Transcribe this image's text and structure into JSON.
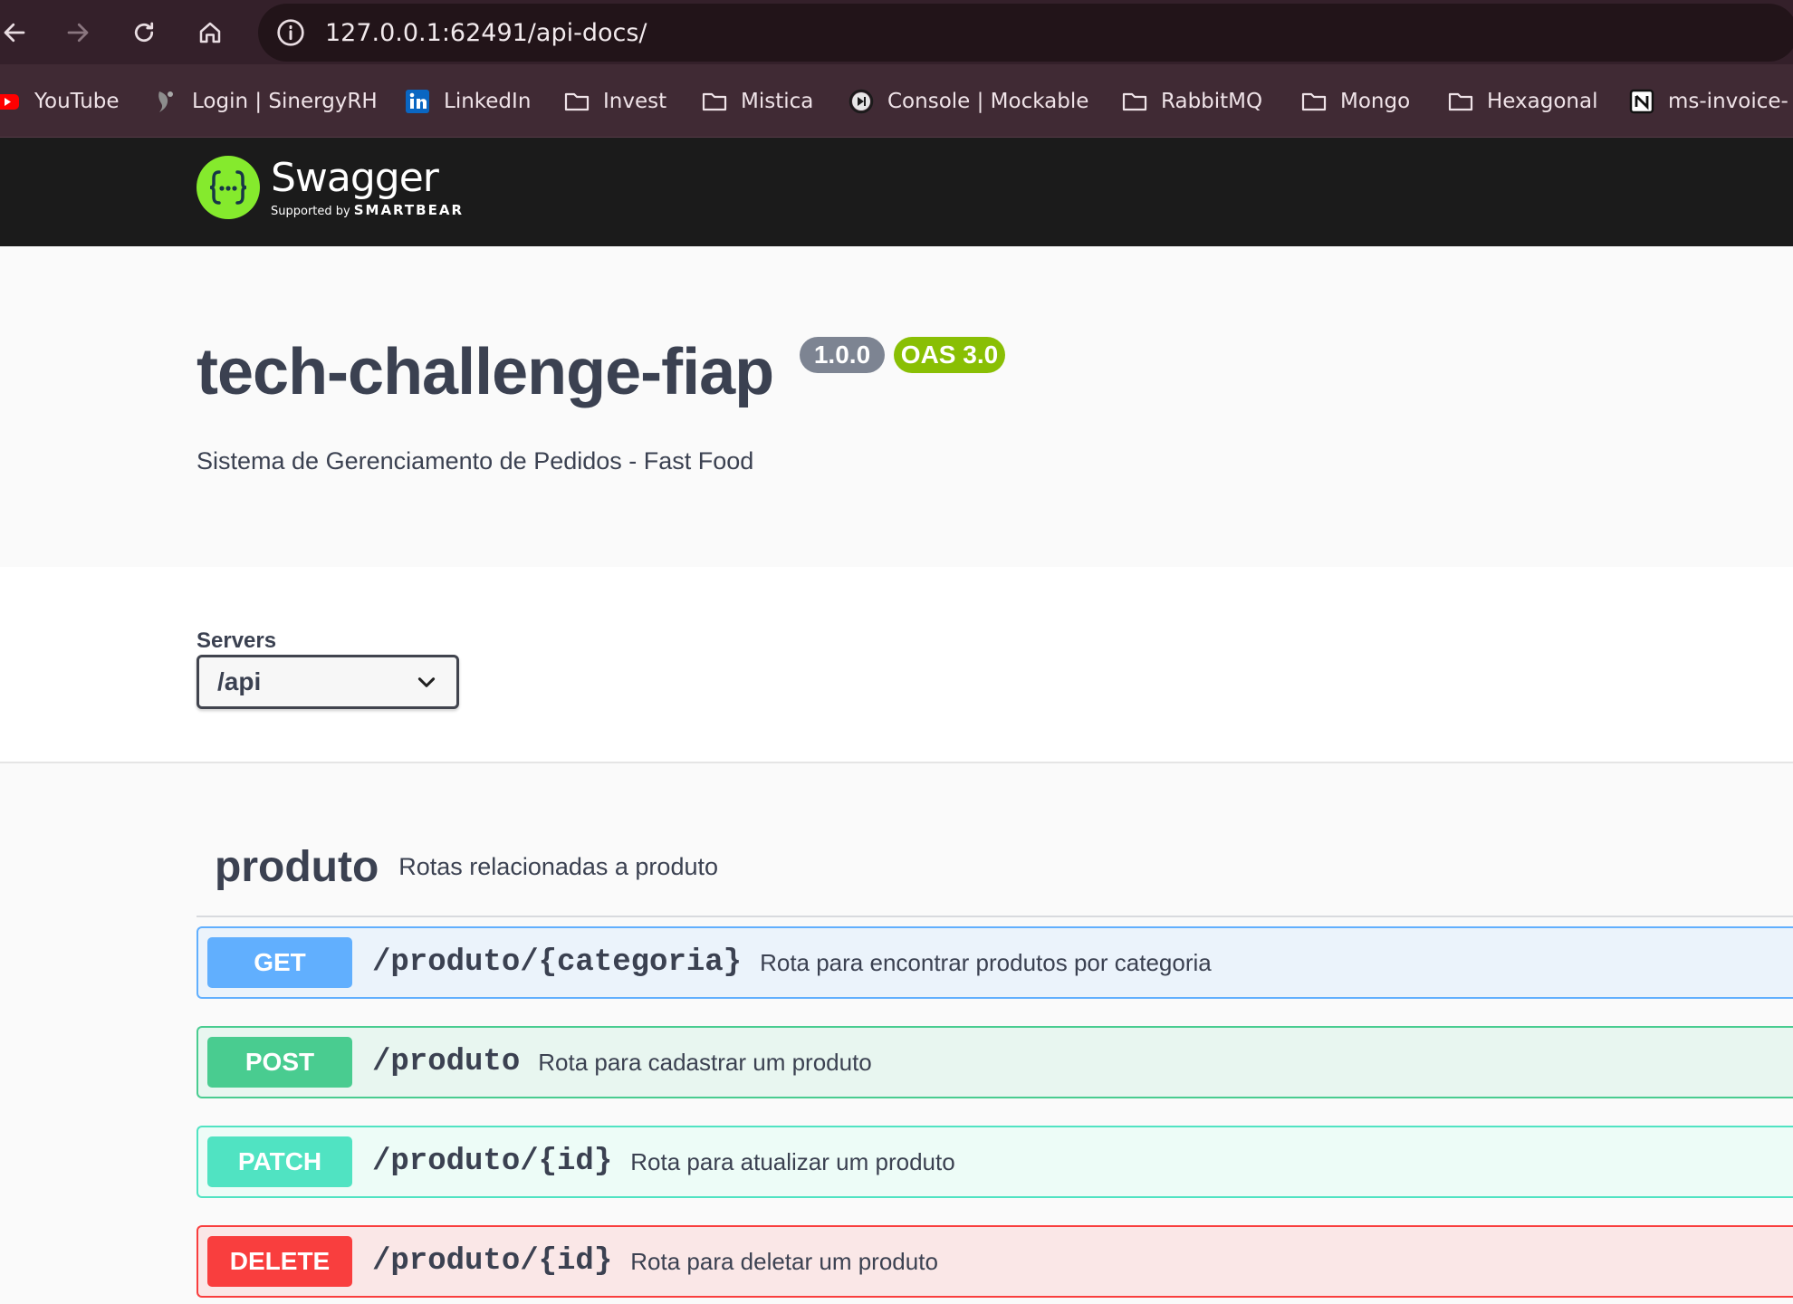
{
  "browser": {
    "url": "127.0.0.1:62491/api-docs/",
    "bookmarks": [
      {
        "label": "YouTube",
        "icon": "youtube-icon"
      },
      {
        "label": "Login | SinergyRH",
        "icon": "sinergy-icon"
      },
      {
        "label": "LinkedIn",
        "icon": "linkedin-icon"
      },
      {
        "label": "Invest",
        "icon": "folder-icon"
      },
      {
        "label": "Mistica",
        "icon": "folder-icon"
      },
      {
        "label": "Console | Mockable",
        "icon": "mockable-icon"
      },
      {
        "label": "RabbitMQ",
        "icon": "folder-icon"
      },
      {
        "label": "Mongo",
        "icon": "folder-icon"
      },
      {
        "label": "Hexagonal",
        "icon": "folder-icon"
      },
      {
        "label": "ms-invoice-",
        "icon": "notion-icon"
      }
    ]
  },
  "swagger": {
    "logo_name": "Swagger",
    "logo_supported": "Supported by",
    "logo_brand": "SMARTBEAR"
  },
  "info": {
    "title": "tech-challenge-fiap",
    "version": "1.0.0",
    "oas": "OAS 3.0",
    "description": "Sistema de Gerenciamento de Pedidos - Fast Food"
  },
  "servers": {
    "label": "Servers",
    "selected": "/api"
  },
  "tag": {
    "name": "produto",
    "description": "Rotas relacionadas a produto"
  },
  "operations": [
    {
      "method": "GET",
      "path": "/produto/{categoria}",
      "summary": "Rota para encontrar produtos por categoria"
    },
    {
      "method": "POST",
      "path": "/produto",
      "summary": "Rota para cadastrar um produto"
    },
    {
      "method": "PATCH",
      "path": "/produto/{id}",
      "summary": "Rota para atualizar um produto"
    },
    {
      "method": "DELETE",
      "path": "/produto/{id}",
      "summary": "Rota para deletar um produto"
    }
  ],
  "colors": {
    "get": "#61affe",
    "post": "#49cc90",
    "patch": "#50e3c2",
    "delete": "#f93e3e",
    "swagger_green": "#85ea2d"
  }
}
